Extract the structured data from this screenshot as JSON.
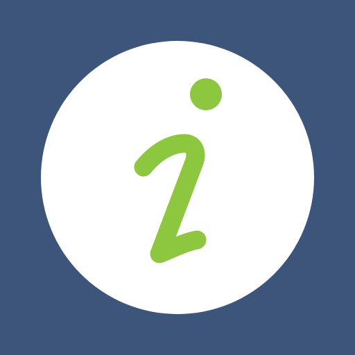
{
  "app_icon": {
    "icon": "info-icon",
    "colors": {
      "background": "#3d557b",
      "circle": "#ffffff",
      "glyph": "#8dc63f"
    }
  }
}
